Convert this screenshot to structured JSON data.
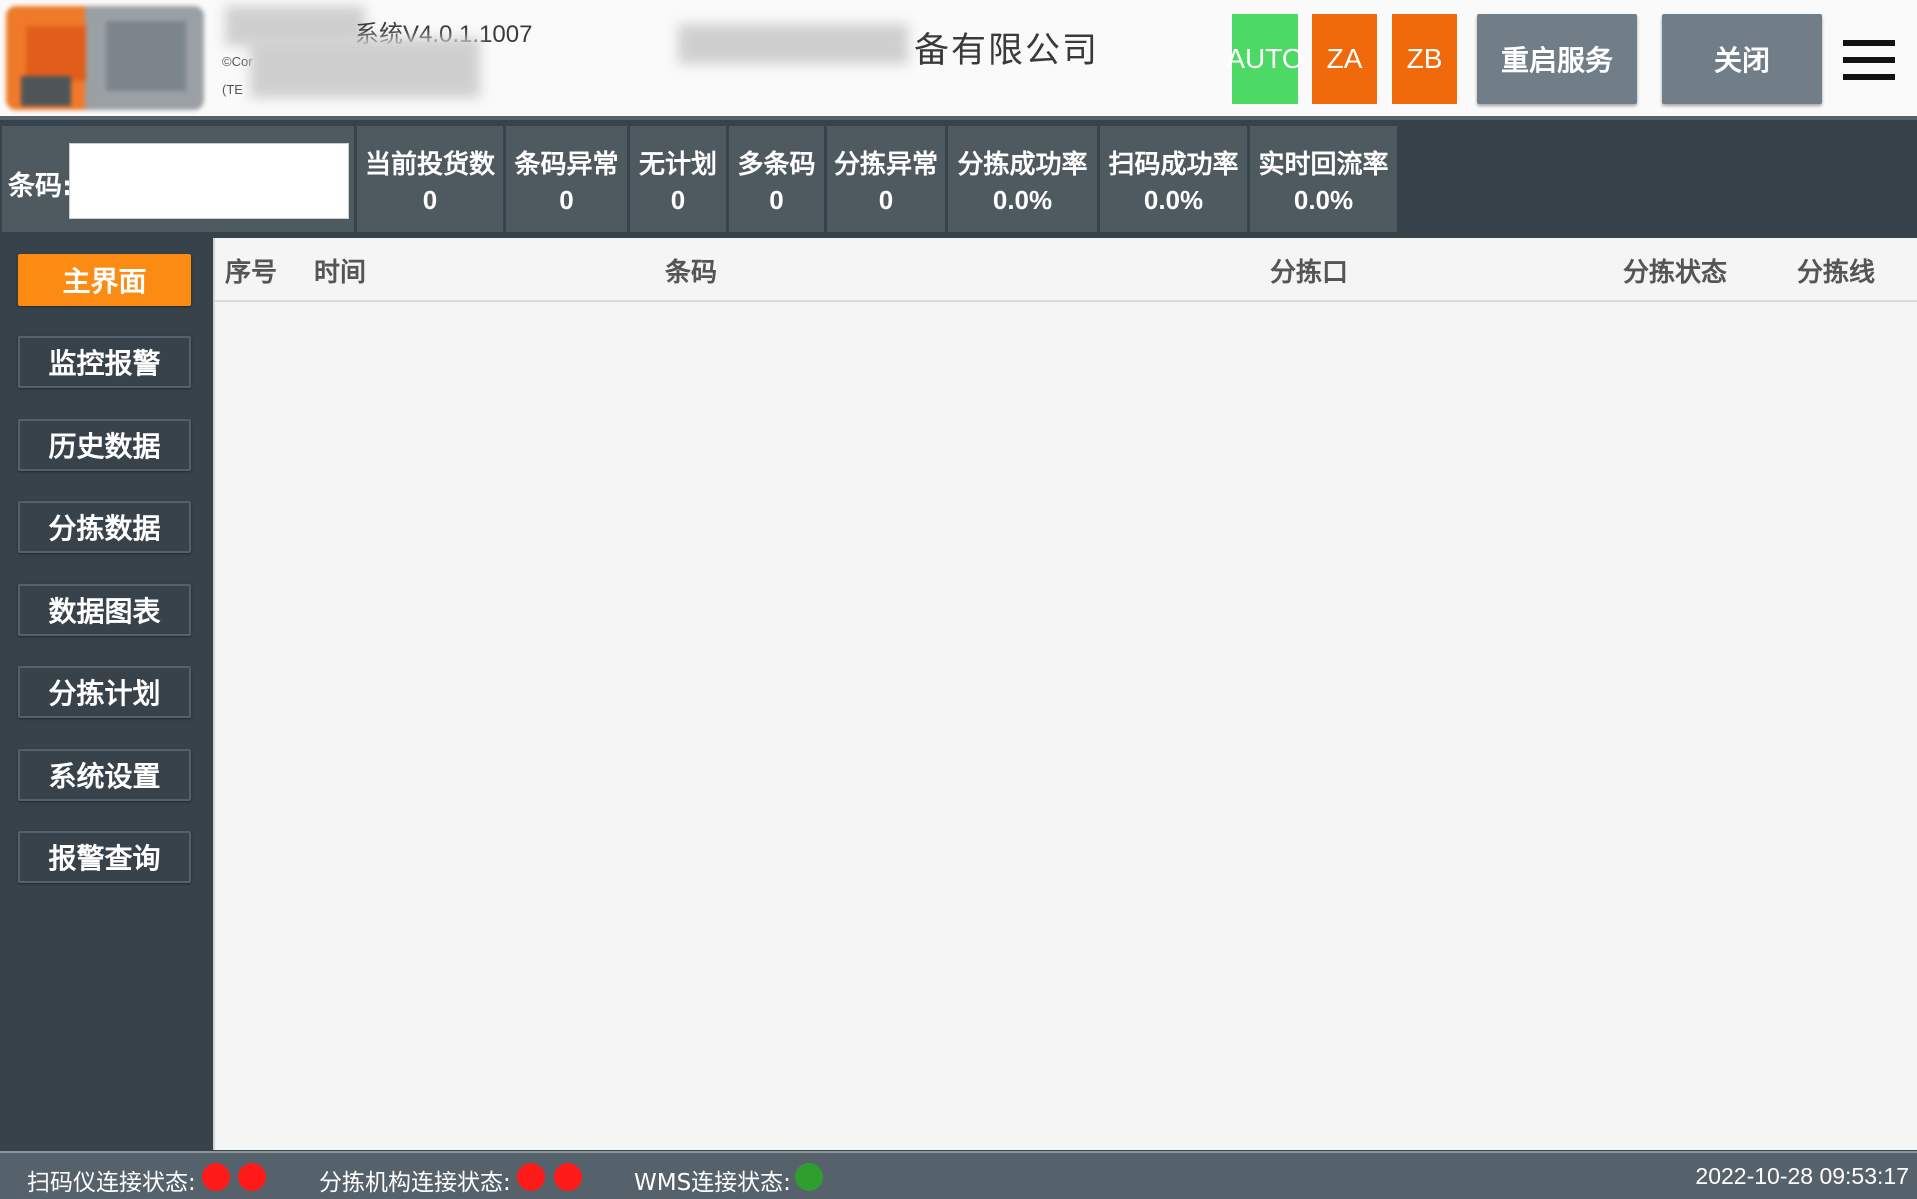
{
  "header": {
    "system_title": "系统V4.0.1.1007",
    "copyright_line1": "©Cor",
    "copyright_line2": "(TE",
    "company_name": "备有限公司",
    "mode_buttons": [
      "AUTO",
      "ZA",
      "ZB"
    ],
    "restart_label": "重启服务",
    "close_label": "关闭",
    "colors": {
      "auto": "#4cd964",
      "za_zb": "#f06a0c",
      "button": "#717d87"
    }
  },
  "barcode": {
    "label": "条码:",
    "value": ""
  },
  "stats": [
    {
      "label": "当前投货数",
      "value": "0"
    },
    {
      "label": "条码异常",
      "value": "0"
    },
    {
      "label": "无计划",
      "value": "0"
    },
    {
      "label": "多条码",
      "value": "0"
    },
    {
      "label": "分拣异常",
      "value": "0"
    },
    {
      "label": "分拣成功率",
      "value": "0.0%"
    },
    {
      "label": "扫码成功率",
      "value": "0.0%"
    },
    {
      "label": "实时回流率",
      "value": "0.0%"
    }
  ],
  "sidebar": {
    "items": [
      {
        "label": "主界面",
        "active": true
      },
      {
        "label": "监控报警"
      },
      {
        "label": "历史数据"
      },
      {
        "label": "分拣数据"
      },
      {
        "label": "数据图表"
      },
      {
        "label": "分拣计划"
      },
      {
        "label": "系统设置"
      },
      {
        "label": "报警查询"
      }
    ],
    "active_color": "#fb8b12"
  },
  "table": {
    "columns": [
      "序号",
      "时间",
      "条码",
      "分拣口",
      "分拣状态",
      "分拣线"
    ],
    "rows": []
  },
  "statusbar": {
    "scanner_label": "扫码仪连接状态:",
    "sorter_label": "分拣机构连接状态:",
    "wms_label": "WMS连接状态:",
    "scanner_status": [
      "disconnected",
      "disconnected"
    ],
    "sorter_status": [
      "disconnected",
      "disconnected"
    ],
    "wms_status": [
      "connected"
    ],
    "datetime": "2022-10-28 09:53:17",
    "colors": {
      "disconnected": "#ff1a1a",
      "connected": "#2f9e2f"
    }
  }
}
